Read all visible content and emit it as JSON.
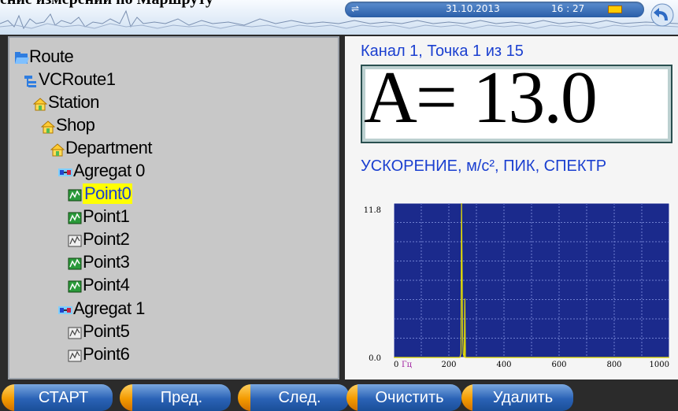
{
  "doc_heading": "ение измерений по Маршруту",
  "status": {
    "date": "31.10.2013",
    "time": "16 : 27",
    "usb_icon": "usb-icon",
    "battery_icon": "battery-icon",
    "back_icon": "back-arrow-icon"
  },
  "tree": {
    "items": [
      {
        "label": "Route",
        "icon": "folder-open-icon",
        "level": 0
      },
      {
        "label": "VCRoute1",
        "icon": "route-tree-icon",
        "level": 1
      },
      {
        "label": "Station",
        "icon": "station-icon",
        "level": 2
      },
      {
        "label": "Shop",
        "icon": "shop-icon",
        "level": 3
      },
      {
        "label": "Department",
        "icon": "department-icon",
        "level": 4
      },
      {
        "label": "Agregat  0",
        "icon": "agregat-icon",
        "level": 5
      },
      {
        "label": "Point0",
        "icon": "point-measured-icon",
        "level": 6,
        "selected": true
      },
      {
        "label": "Point1",
        "icon": "point-measured-icon",
        "level": 6
      },
      {
        "label": "Point2",
        "icon": "point-empty-icon",
        "level": 6
      },
      {
        "label": "Point3",
        "icon": "point-measured-icon",
        "level": 6
      },
      {
        "label": "Point4",
        "icon": "point-measured-icon",
        "level": 6
      },
      {
        "label": "Agregat  1",
        "icon": "agregat-icon",
        "level": 5
      },
      {
        "label": "Point5",
        "icon": "point-empty-icon",
        "level": 6
      },
      {
        "label": "Point6",
        "icon": "point-empty-icon",
        "level": 6
      }
    ]
  },
  "measurement": {
    "channel_title": "Канал  1,  Точка  1  из  15",
    "value_display": "A=   13.0",
    "type_label": "УСКОРЕНИЕ,  м/с²,  ПИК,  СПЕКТР"
  },
  "chart_data": {
    "type": "line",
    "x_unit_label": "Гц",
    "x_ticks": [
      "0",
      "200",
      "400",
      "600",
      "800",
      "1000"
    ],
    "y_ticks": [
      "11.8",
      "0.0"
    ],
    "xlim": [
      0,
      1000
    ],
    "ylim": [
      0,
      11.8
    ],
    "grid": true,
    "colors": {
      "plot_bg": "#1b2a8c",
      "line": "#e8e000",
      "grid": "#6f7fd0"
    },
    "series": [
      {
        "x": [
          0,
          240,
          244,
          246,
          248,
          250,
          252,
          256,
          258,
          260,
          1000
        ],
        "values": [
          0,
          0,
          0.3,
          11.8,
          7.0,
          1.5,
          0.3,
          0,
          4.5,
          0,
          0
        ]
      }
    ]
  },
  "softkeys": [
    {
      "label": "СТАРТ"
    },
    {
      "label": "Пред."
    },
    {
      "label": "След."
    },
    {
      "label": "Очистить"
    },
    {
      "label": "Удалить"
    }
  ]
}
